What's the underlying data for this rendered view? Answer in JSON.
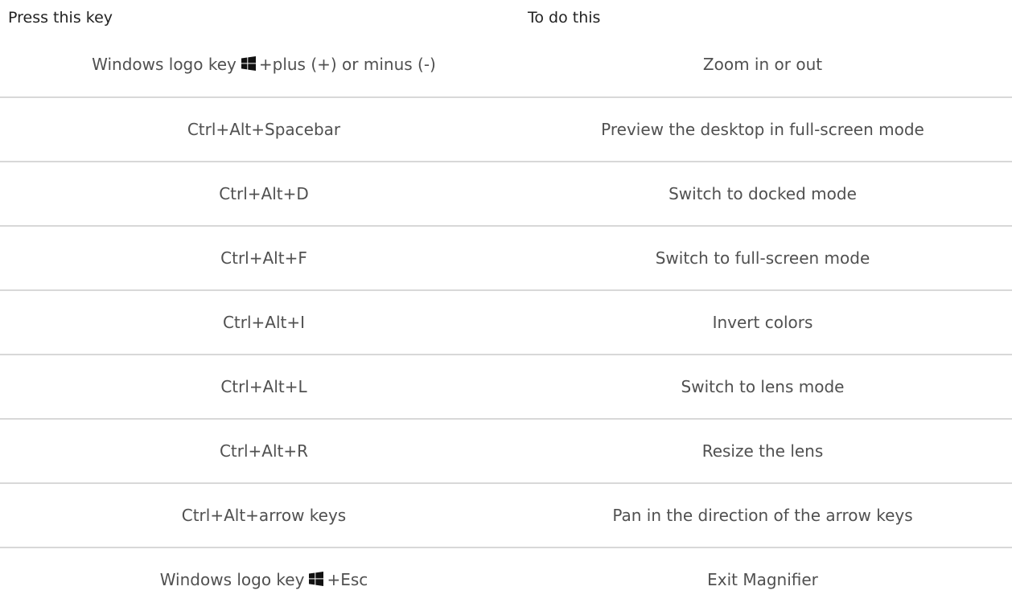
{
  "header": {
    "key_label": "Press this key",
    "action_label": "To do this"
  },
  "icons": {
    "windows_logo": "windows-logo-icon"
  },
  "rows": [
    {
      "key_prefix": "Windows logo key",
      "key_suffix": "+plus (+) or minus (-)",
      "action": "Zoom in or out"
    },
    {
      "key": "Ctrl+Alt+Spacebar",
      "action": "Preview the desktop in full-screen mode"
    },
    {
      "key": "Ctrl+Alt+D",
      "action": "Switch to docked mode"
    },
    {
      "key": "Ctrl+Alt+F",
      "action": "Switch to full-screen mode"
    },
    {
      "key": "Ctrl+Alt+I",
      "action": "Invert colors"
    },
    {
      "key": "Ctrl+Alt+L",
      "action": "Switch to lens mode"
    },
    {
      "key": "Ctrl+Alt+R",
      "action": "Resize the lens"
    },
    {
      "key": "Ctrl+Alt+arrow keys",
      "action": "Pan in the direction of the arrow keys"
    },
    {
      "key_prefix": "Windows logo key",
      "key_suffix": "+Esc",
      "action": "Exit Magnifier"
    }
  ]
}
